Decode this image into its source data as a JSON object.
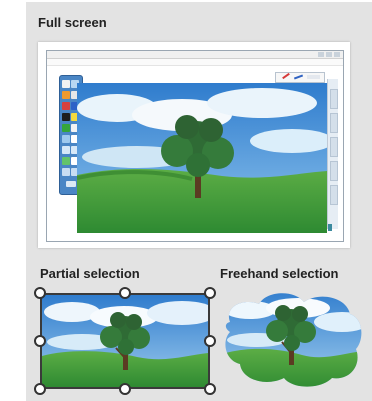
{
  "sections": {
    "full_screen": "Full screen",
    "partial_selection": "Partial selection",
    "freehand_selection": "Freehand selection"
  },
  "colors": {
    "panel_background": "#e3e3e3",
    "toolbox_blue": "#4a86c5",
    "sky_blue": "#3f86c9",
    "grass_green": "#3f9a3a",
    "tree_green": "#2f6b35"
  },
  "icons": {
    "toolbox": "screen-capture-toolbox",
    "pen": "pen-icon",
    "handles": "selection-handle"
  }
}
